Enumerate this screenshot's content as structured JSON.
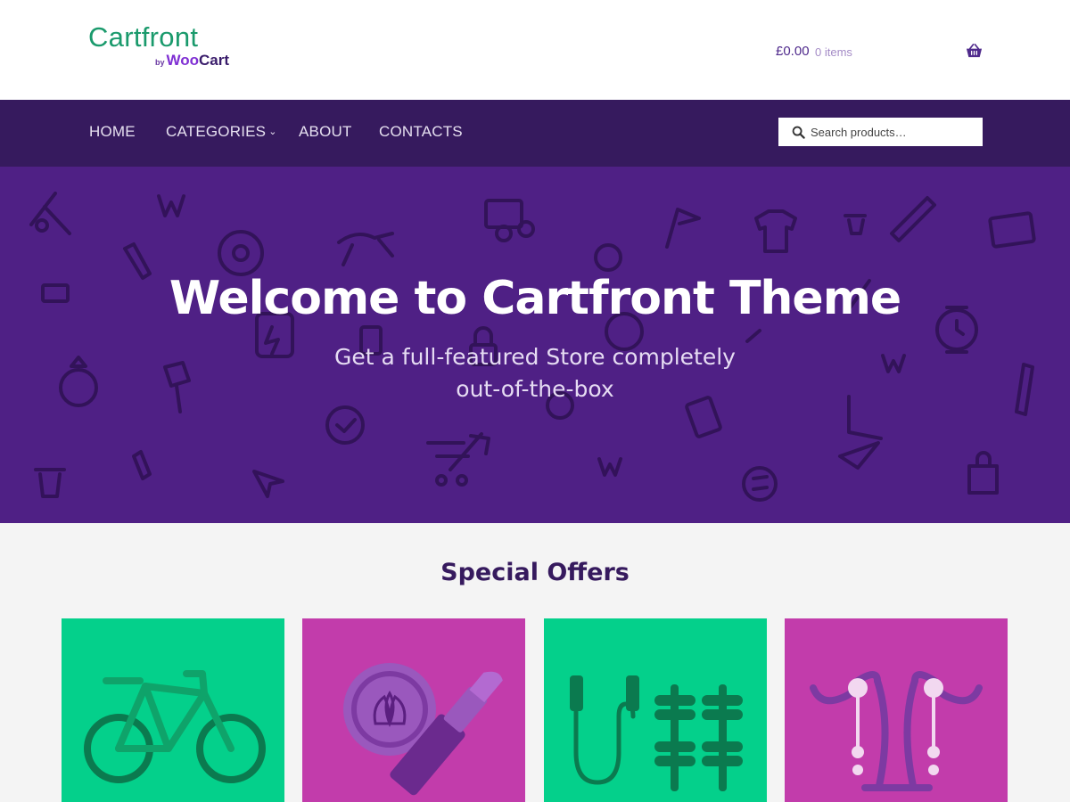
{
  "header": {
    "logo": {
      "name": "Cartfront",
      "by": "by",
      "woo": "Woo",
      "cart": "Cart"
    },
    "cart": {
      "amount": "£0.00",
      "count": "0 items",
      "icon": "basket-icon"
    }
  },
  "nav": {
    "items": [
      {
        "label": "HOME"
      },
      {
        "label": "CATEGORIES",
        "has_dropdown": true
      },
      {
        "label": "ABOUT"
      },
      {
        "label": "CONTACTS"
      }
    ],
    "search": {
      "placeholder": "Search products…",
      "icon": "search-icon"
    }
  },
  "hero": {
    "title": "Welcome to Cartfront Theme",
    "subtitle_line1": "Get a full-featured Store completely",
    "subtitle_line2": "out-of-the-box"
  },
  "offers": {
    "title": "Special Offers",
    "products": [
      {
        "image": "bicycle-icon",
        "bg": "#04d08b"
      },
      {
        "image": "lipstick-icon",
        "bg": "#c23cab"
      },
      {
        "image": "fitness-icon",
        "bg": "#04d08b"
      },
      {
        "image": "earrings-icon",
        "bg": "#c23cab"
      }
    ]
  },
  "colors": {
    "brand_green": "#1a9a6c",
    "nav_bg": "#361a5e",
    "hero_bg": "#4f2085",
    "accent_purple": "#7f2fd3"
  }
}
